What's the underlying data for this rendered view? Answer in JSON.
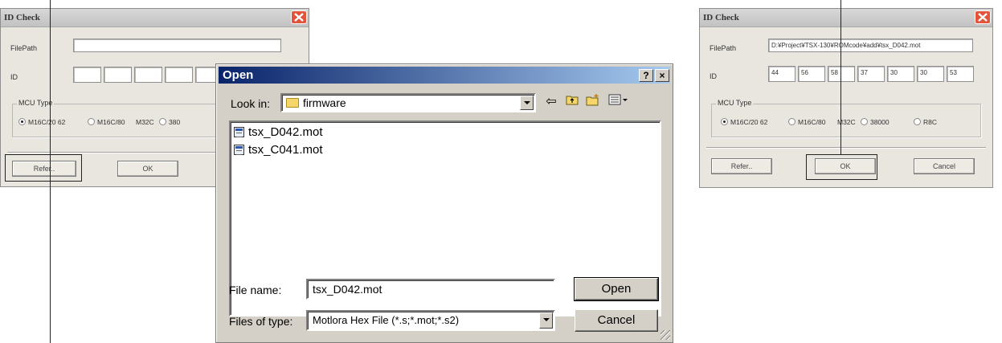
{
  "left_dialog": {
    "title": "ID Check",
    "filepath_label": "FilePath",
    "filepath_value": "",
    "id_label": "ID",
    "id_values": [
      "",
      "",
      "",
      "",
      ""
    ],
    "mcu_group": "MCU Type",
    "mcu_options": [
      "M16C/20 62",
      "M16C/80",
      "M32C",
      "380"
    ],
    "refer_button": "Refer..",
    "ok_button": "OK"
  },
  "open_dialog": {
    "title": "Open",
    "help_button": "?",
    "close_button": "×",
    "look_in_label": "Look in:",
    "look_in_value": "firmware",
    "files": [
      "tsx_D042.mot",
      "tsx_C041.mot"
    ],
    "file_name_label": "File name:",
    "file_name_value": "tsx_D042.mot",
    "file_type_label": "Files of type:",
    "file_type_value": "Motlora Hex File (*.s;*.mot;*.s2)",
    "open_button": "Open",
    "cancel_button": "Cancel"
  },
  "right_dialog": {
    "title": "ID Check",
    "filepath_label": "FilePath",
    "filepath_value": "D:¥Project¥TSX-130¥ROMcode¥add¥tsx_D042.mot",
    "id_label": "ID",
    "id_values": [
      "44",
      "56",
      "58",
      "37",
      "30",
      "30",
      "53"
    ],
    "mcu_group": "MCU Type",
    "mcu_options": [
      "M16C/20 62",
      "M16C/80",
      "M32C",
      "38000",
      "R8C"
    ],
    "refer_button": "Refer..",
    "ok_button": "OK",
    "cancel_button": "Cancel"
  }
}
